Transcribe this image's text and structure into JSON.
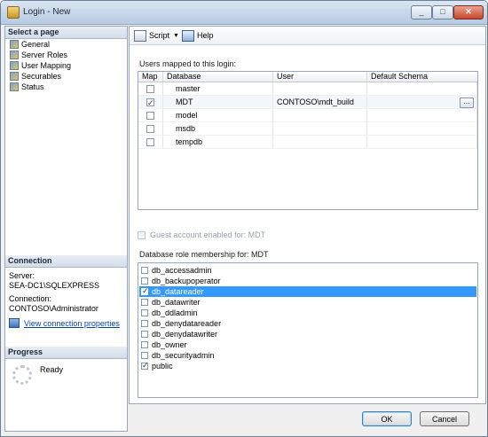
{
  "window": {
    "title": "Login - New",
    "minimize": "_",
    "maximize": "□",
    "close": "✕"
  },
  "left": {
    "select_page_header": "Select a page",
    "pages": [
      {
        "label": "General"
      },
      {
        "label": "Server Roles"
      },
      {
        "label": "User Mapping"
      },
      {
        "label": "Securables"
      },
      {
        "label": "Status"
      }
    ],
    "connection_header": "Connection",
    "server_label": "Server:",
    "server_value": "SEA-DC1\\SQLEXPRESS",
    "connection_label": "Connection:",
    "connection_value": "CONTOSO\\Administrator",
    "view_connection_link": "View connection properties",
    "progress_header": "Progress",
    "progress_status": "Ready"
  },
  "toolbar": {
    "script_label": "Script",
    "help_label": "Help"
  },
  "users_mapped": {
    "caption": "Users mapped to this login:",
    "columns": [
      "Map",
      "Database",
      "User",
      "Default Schema"
    ],
    "rows": [
      {
        "map": false,
        "database": "master",
        "user": "",
        "schema": ""
      },
      {
        "map": true,
        "database": "MDT",
        "user": "CONTOSO\\mdt_build",
        "schema": ""
      },
      {
        "map": false,
        "database": "model",
        "user": "",
        "schema": ""
      },
      {
        "map": false,
        "database": "msdb",
        "user": "",
        "schema": ""
      },
      {
        "map": false,
        "database": "tempdb",
        "user": "",
        "schema": ""
      }
    ],
    "ellipsis_label": "..."
  },
  "guest_account": {
    "label": "Guest account enabled for: MDT",
    "checked": false,
    "enabled": false
  },
  "role_membership": {
    "caption": "Database role membership for: MDT",
    "roles": [
      {
        "name": "db_accessadmin",
        "checked": false
      },
      {
        "name": "db_backupoperator",
        "checked": false
      },
      {
        "name": "db_datareader",
        "checked": true,
        "selected": true
      },
      {
        "name": "db_datawriter",
        "checked": false
      },
      {
        "name": "db_ddladmin",
        "checked": false
      },
      {
        "name": "db_denydatareader",
        "checked": false
      },
      {
        "name": "db_denydatawriter",
        "checked": false
      },
      {
        "name": "db_owner",
        "checked": false
      },
      {
        "name": "db_securityadmin",
        "checked": false
      },
      {
        "name": "public",
        "checked": true
      }
    ]
  },
  "buttons": {
    "ok": "OK",
    "cancel": "Cancel"
  }
}
